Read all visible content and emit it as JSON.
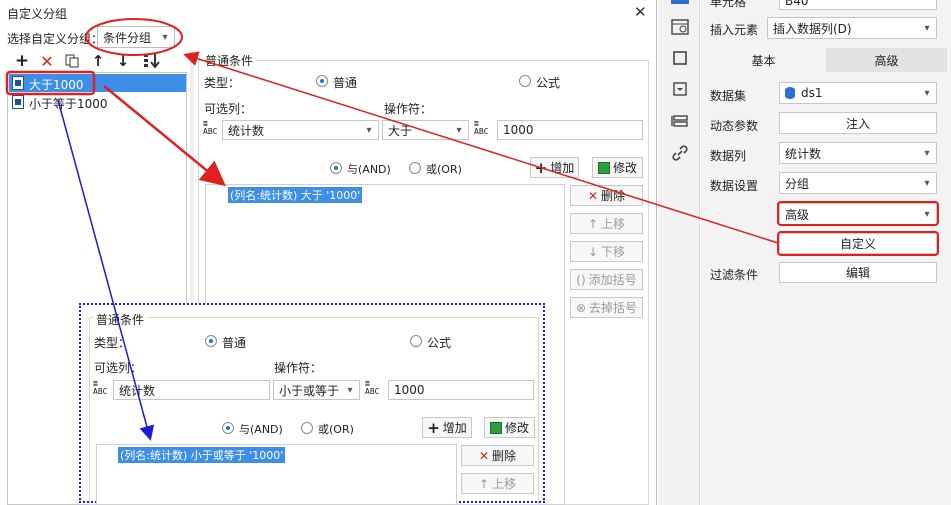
{
  "dialog": {
    "title": "自定义分组",
    "close_glyph": "✕",
    "group_select_label": "选择自定义分组：",
    "group_select_value": "条件分组",
    "tree_items": [
      "大于1000",
      "小于等于1000"
    ]
  },
  "condition": {
    "section_title": "普通条件",
    "type_label": "类型：",
    "type_normal": "普通",
    "type_formula": "公式",
    "column_label": "可选列：",
    "column_value": "统计数",
    "operator_label": "操作符：",
    "operator_value": "大于",
    "value": "1000",
    "and_label": "与(AND)",
    "or_label": "或(OR)",
    "add_label": "增加",
    "modify_label": "修改",
    "condition_text": "(列名:统计数) 大于 '1000'",
    "delete_label": "删除",
    "up_label": "上移",
    "down_label": "下移",
    "add_paren_label": "添加括号",
    "remove_paren_label": "去掉括号"
  },
  "zoom_condition": {
    "section_title": "普通条件",
    "type_label": "类型：",
    "type_normal": "普通",
    "type_formula": "公式",
    "column_label": "可选列：",
    "column_value": "统计数",
    "operator_label": "操作符：",
    "operator_value": "小于或等于",
    "value": "1000",
    "and_label": "与(AND)",
    "or_label": "或(OR)",
    "add_label": "增加",
    "modify_label": "修改",
    "condition_text": "(列名:统计数) 小于或等于 '1000'",
    "delete_label": "删除",
    "up_label": "上移"
  },
  "right_panel": {
    "cell_label": "单元格",
    "cell_value": "B40",
    "insert_label": "插入元素",
    "insert_value": "插入数据列(D)",
    "tab_basic": "基本",
    "tab_advanced": "高级",
    "dataset_label": "数据集",
    "dataset_value": "ds1",
    "dynamic_param_label": "动态参数",
    "inject_button": "注入",
    "column_label": "数据列",
    "column_value": "统计数",
    "setting_label": "数据设置",
    "setting_value": "分组",
    "setting_sub_value": "高级",
    "custom_button": "自定义",
    "filter_label": "过滤条件",
    "edit_button": "编辑"
  },
  "colors": {
    "highlight_red": "#e02020",
    "arrow_blue": "#1a1adb",
    "selection_blue": "#3c8ee6",
    "tab_grey": "#e6e6e6"
  }
}
